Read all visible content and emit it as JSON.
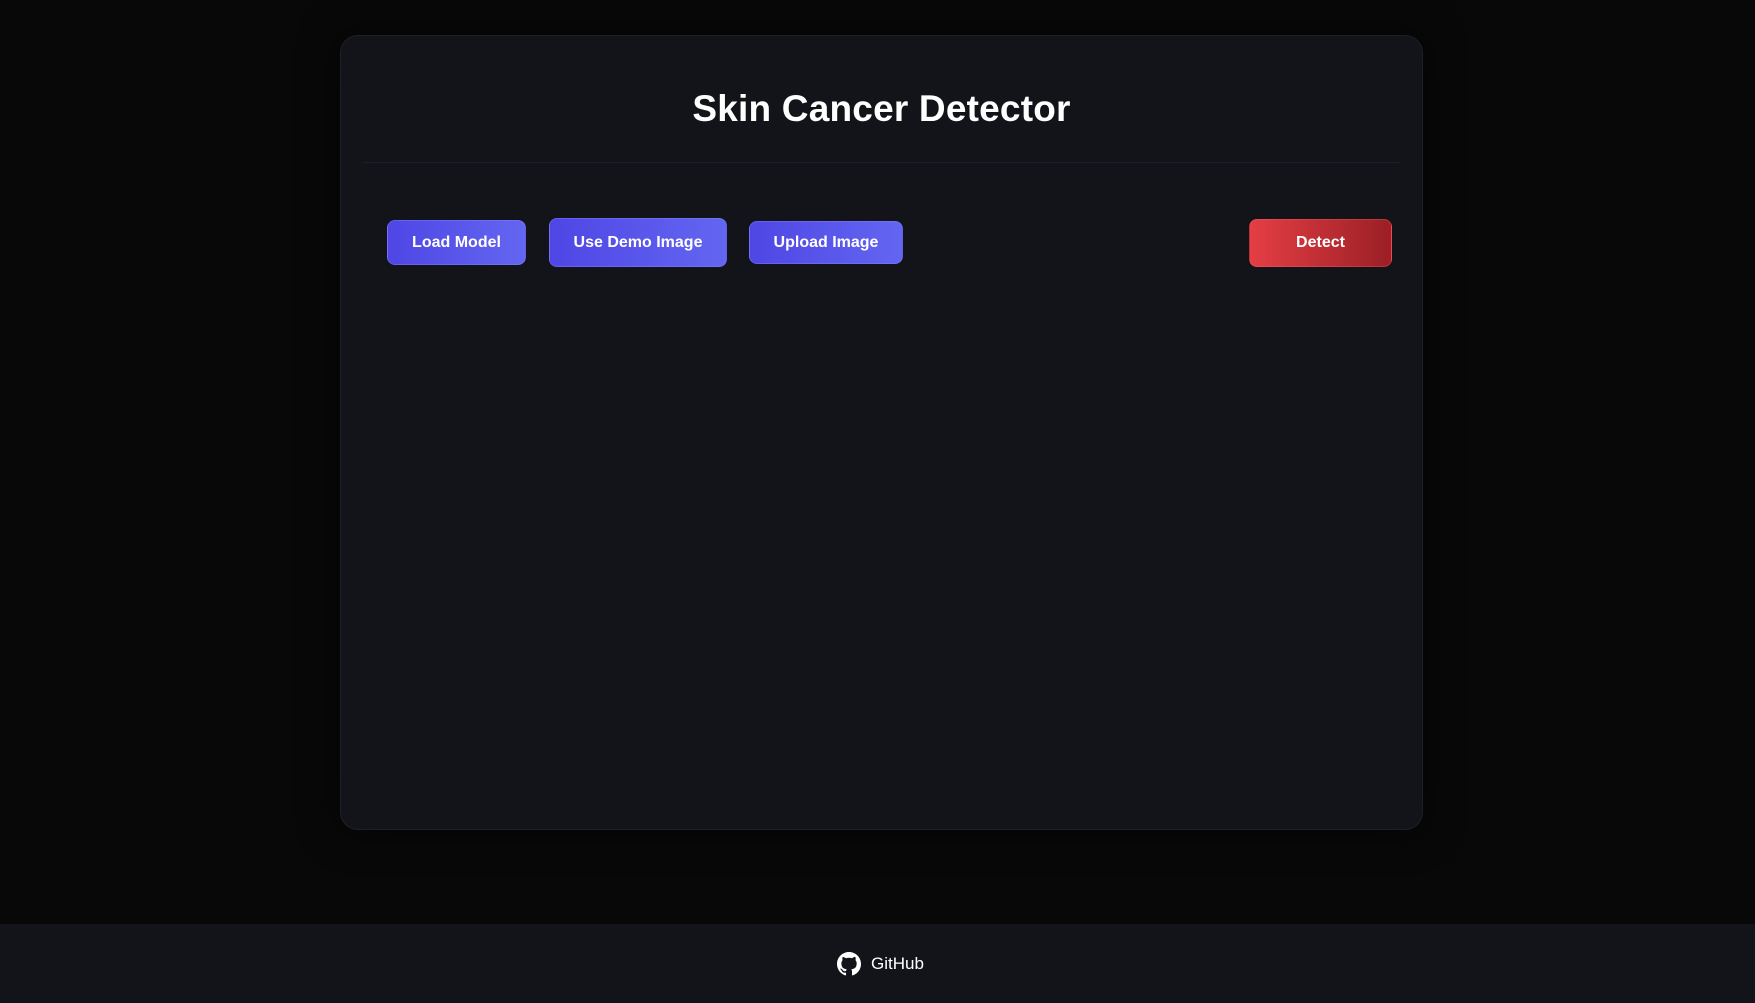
{
  "app": {
    "title": "Skin Cancer Detector"
  },
  "toolbar": {
    "load_model_label": "Load Model",
    "demo_image_label": "Use Demo Image",
    "upload_image_label": "Upload Image",
    "detect_label": "Detect"
  },
  "footer": {
    "github_label": "GitHub",
    "github_icon": "github-icon"
  },
  "colors": {
    "background": "#080808",
    "card": "#13141a",
    "primary_accent": "#4f46e5",
    "danger_accent": "#e53e45"
  }
}
